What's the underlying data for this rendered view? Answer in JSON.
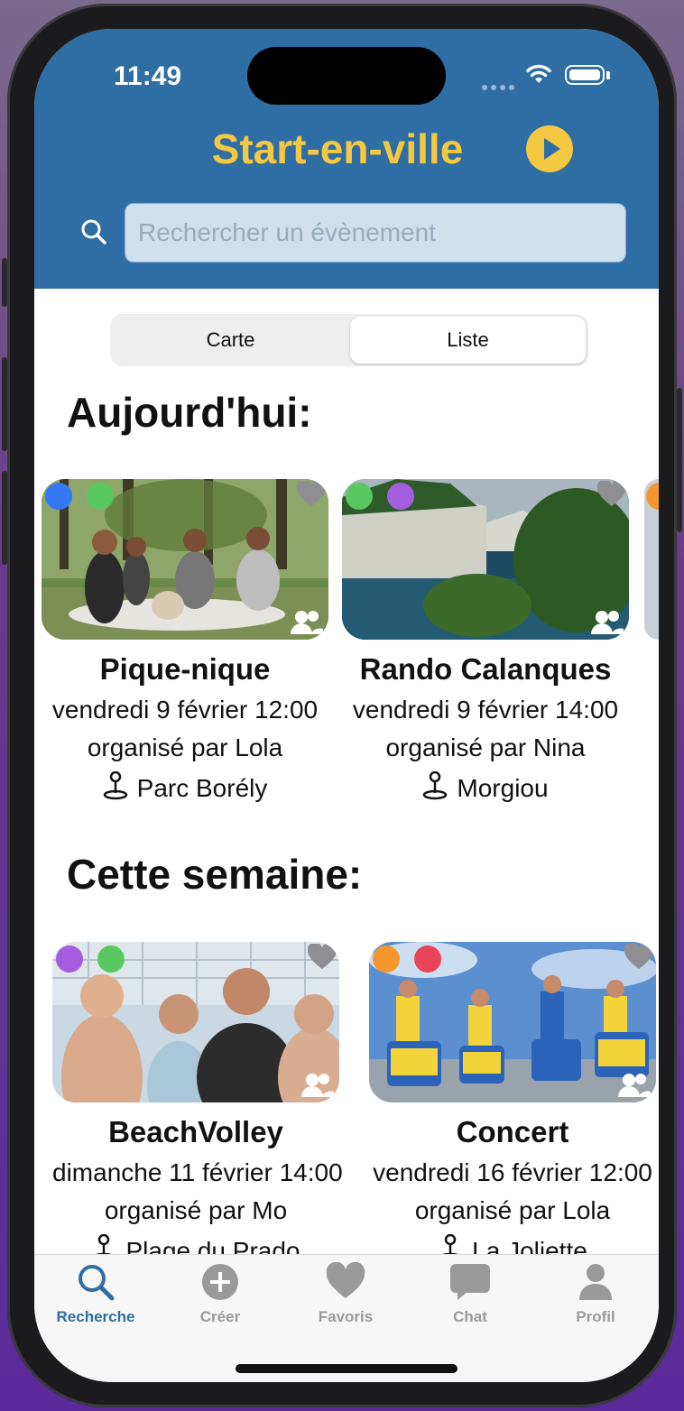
{
  "status_bar": {
    "time": "11:49"
  },
  "header": {
    "title": "Start-en-ville",
    "search_placeholder": "Rechercher un évènement"
  },
  "segmented": {
    "left": "Carte",
    "right": "Liste",
    "selected": "Liste"
  },
  "sections": [
    {
      "title": "Aujourd'hui:",
      "events": [
        {
          "name": "Pique-nique",
          "date": "vendredi 9 février 12:00",
          "organizer": "organisé par Lola",
          "location": "Parc Borély",
          "dots": [
            "#3478f6",
            "#5ac860"
          ]
        },
        {
          "name": "Rando Calanques",
          "date": "vendredi 9 février 14:00",
          "organizer": "organisé par Nina",
          "location": "Morgiou",
          "dots": [
            "#5ac860",
            "#a55de0"
          ]
        }
      ]
    },
    {
      "title": "Cette semaine:",
      "events": [
        {
          "name": "BeachVolley",
          "date": "dimanche 11 février 14:00",
          "organizer": "organisé par Mo",
          "location": "Plage du Prado",
          "dots": [
            "#a55de0",
            "#5ac860"
          ]
        },
        {
          "name": "Concert",
          "date": "vendredi 16 février 12:00",
          "organizer": "organisé par Lola",
          "location": "La Joliette",
          "dots": [
            "#f5962f",
            "#e8445a"
          ]
        }
      ]
    }
  ],
  "tabs": [
    {
      "label": "Recherche",
      "icon": "search-icon",
      "active": true
    },
    {
      "label": "Créer",
      "icon": "plus-circle-icon",
      "active": false
    },
    {
      "label": "Favoris",
      "icon": "heart-icon",
      "active": false
    },
    {
      "label": "Chat",
      "icon": "chat-bubble-icon",
      "active": false
    },
    {
      "label": "Profil",
      "icon": "person-icon",
      "active": false
    }
  ],
  "colors": {
    "header": "#2f6ea4",
    "accent": "#f5c842",
    "tab_active": "#2f6ea4",
    "tab_inactive": "#9a9a9a"
  }
}
